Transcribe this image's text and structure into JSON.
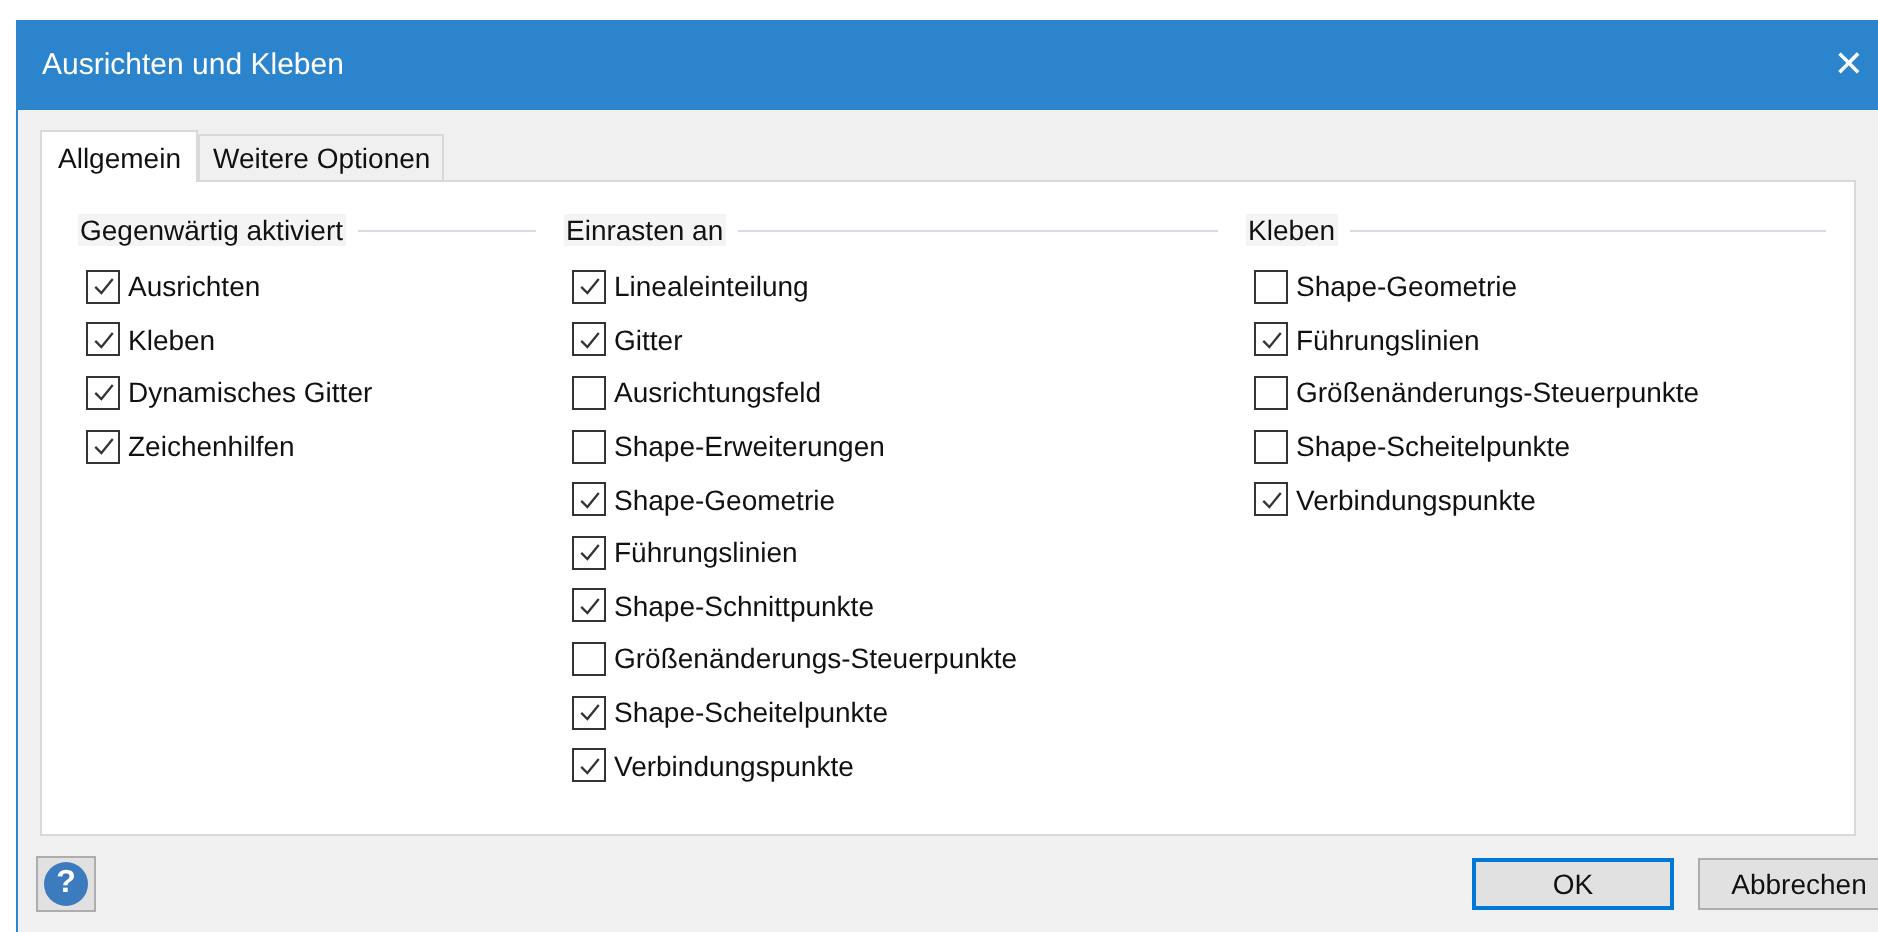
{
  "window": {
    "title": "Ausrichten und Kleben",
    "close": "✕"
  },
  "tabs": [
    {
      "label": "Allgemein",
      "selected": true
    },
    {
      "label": "Weitere Optionen",
      "selected": false
    }
  ],
  "groups": [
    {
      "title": "Gegenwärtig aktiviert",
      "items": [
        {
          "label": "Ausrichten",
          "checked": true
        },
        {
          "label": "Kleben",
          "checked": true
        },
        {
          "label": "Dynamisches Gitter",
          "checked": true
        },
        {
          "label": "Zeichenhilfen",
          "checked": true
        }
      ]
    },
    {
      "title": "Einrasten an",
      "items": [
        {
          "label": "Linealeinteilung",
          "checked": true
        },
        {
          "label": "Gitter",
          "checked": true
        },
        {
          "label": "Ausrichtungsfeld",
          "checked": false
        },
        {
          "label": "Shape-Erweiterungen",
          "checked": false
        },
        {
          "label": "Shape-Geometrie",
          "checked": true
        },
        {
          "label": "Führungslinien",
          "checked": true
        },
        {
          "label": "Shape-Schnittpunkte",
          "checked": true
        },
        {
          "label": "Größenänderungs-Steuerpunkte",
          "checked": false
        },
        {
          "label": "Shape-Scheitelpunkte",
          "checked": true
        },
        {
          "label": "Verbindungspunkte",
          "checked": true
        }
      ]
    },
    {
      "title": "Kleben",
      "items": [
        {
          "label": "Shape-Geometrie",
          "checked": false
        },
        {
          "label": "Führungslinien",
          "checked": true
        },
        {
          "label": "Größenänderungs-Steuerpunkte",
          "checked": false
        },
        {
          "label": "Shape-Scheitelpunkte",
          "checked": false
        },
        {
          "label": "Verbindungspunkte",
          "checked": true
        }
      ]
    }
  ],
  "help": {
    "label": "?"
  },
  "buttons": [
    {
      "label": "OK",
      "default": true
    },
    {
      "label": "Abbrechen",
      "default": false
    }
  ]
}
